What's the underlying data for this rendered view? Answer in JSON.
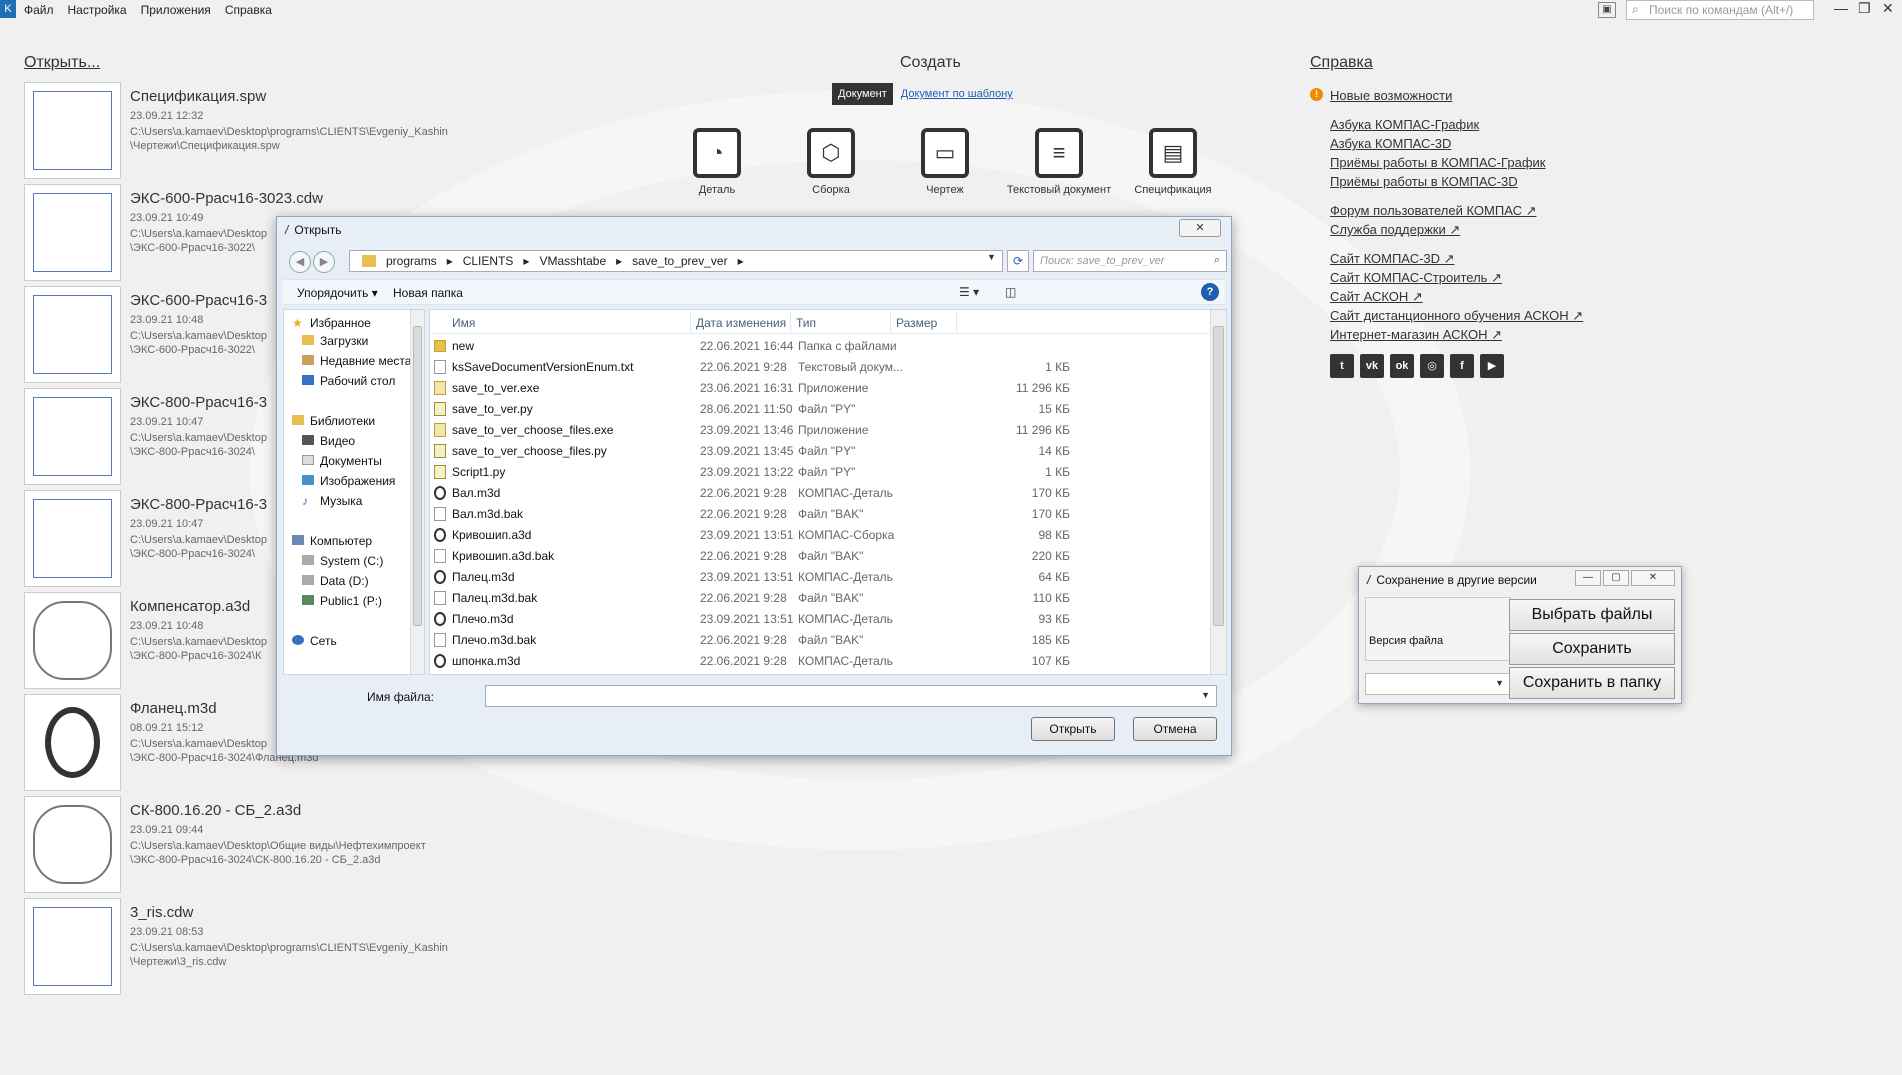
{
  "menu": {
    "items": [
      "Файл",
      "Настройка",
      "Приложения",
      "Справка"
    ],
    "search_placeholder": "Поиск по командам (Alt+/)"
  },
  "sections": {
    "open": "Открыть...",
    "create": "Создать",
    "help": "Справка"
  },
  "recent": [
    {
      "name": "Спецификация.spw",
      "date": "23.09.21 12:32",
      "path": "C:\\Users\\a.kamaev\\Desktop\\programs\\CLIENTS\\Evgeniy_Kashin\n\\Чертежи\\Спецификация.spw"
    },
    {
      "name": "ЭКС-600-Ррасч16-3023.cdw",
      "date": "23.09.21 10:49",
      "path": "C:\\Users\\a.kamaev\\Desktop\n\\ЭКС-600-Ррасч16-3022\\"
    },
    {
      "name": "ЭКС-600-Ррасч16-3",
      "date": "23.09.21 10:48",
      "path": "C:\\Users\\a.kamaev\\Desktop\n\\ЭКС-600-Ррасч16-3022\\"
    },
    {
      "name": "ЭКС-800-Ррасч16-3",
      "date": "23.09.21 10:47",
      "path": "C:\\Users\\a.kamaev\\Desktop\n\\ЭКС-800-Ррасч16-3024\\"
    },
    {
      "name": "ЭКС-800-Ррасч16-3",
      "date": "23.09.21 10:47",
      "path": "C:\\Users\\a.kamaev\\Desktop\n\\ЭКС-800-Ррасч16-3024\\"
    },
    {
      "name": "Компенсатор.a3d",
      "date": "23.09.21 10:48",
      "path": "C:\\Users\\a.kamaev\\Desktop\n\\ЭКС-800-Ррасч16-3024\\К"
    },
    {
      "name": "Фланец.m3d",
      "date": "08.09.21 15:12",
      "path": "C:\\Users\\a.kamaev\\Desktop\n\\ЭКС-800-Ррасч16-3024\\Фланец.m3d"
    },
    {
      "name": "СК-800.16.20 - СБ_2.a3d",
      "date": "23.09.21 09:44",
      "path": "C:\\Users\\a.kamaev\\Desktop\\Общие виды\\Нефтехимпроект\n\\ЭКС-800-Ррасч16-3024\\СК-800.16.20 - СБ_2.a3d"
    },
    {
      "name": "3_ris.cdw",
      "date": "23.09.21 08:53",
      "path": "C:\\Users\\a.kamaev\\Desktop\\programs\\CLIENTS\\Evgeniy_Kashin\n\\Чертежи\\3_ris.cdw"
    }
  ],
  "create": {
    "tab_document": "Документ",
    "tab_template": "Документ по шаблону",
    "items": [
      "Деталь",
      "Сборка",
      "Чертеж",
      "Текстовый документ",
      "Спецификация"
    ]
  },
  "help": {
    "whats_new": "Новые возможности",
    "group1": [
      "Азбука КОМПАС-График",
      "Азбука КОМПАС-3D",
      "Приёмы работы в КОМПАС-График",
      "Приёмы работы в КОМПАС-3D"
    ],
    "group2": [
      "Форум пользователей КОМПАС ↗",
      "Служба поддержки ↗"
    ],
    "group3": [
      "Сайт КОМПАС-3D ↗",
      "Сайт КОМПАС-Строитель ↗",
      "Сайт АСКОН ↗",
      "Сайт дистанционного обучения АСКОН ↗",
      "Интернет-магазин АСКОН ↗"
    ]
  },
  "dialog": {
    "title": "Открыть",
    "close": "✕",
    "breadcrumb": [
      "programs",
      "CLIENTS",
      "VMasshtabe",
      "save_to_prev_ver"
    ],
    "search_placeholder": "Поиск: save_to_prev_ver",
    "organize": "Упорядочить ▾",
    "new_folder": "Новая папка",
    "tree": {
      "favorites": "Избранное",
      "downloads": "Загрузки",
      "recent": "Недавние места",
      "desktop": "Рабочий стол",
      "libraries": "Библиотеки",
      "video": "Видео",
      "documents": "Документы",
      "images": "Изображения",
      "music": "Музыка",
      "computer": "Компьютер",
      "drive_c": "System (C:)",
      "drive_d": "Data (D:)",
      "drive_p": "Public1 (P:)",
      "network": "Сеть"
    },
    "columns": {
      "name": "Имя",
      "date": "Дата изменения",
      "type": "Тип",
      "size": "Размер"
    },
    "files": [
      {
        "name": "new",
        "date": "22.06.2021 16:44",
        "type": "Папка с файлами",
        "size": "",
        "icon": "folder"
      },
      {
        "name": "ksSaveDocumentVersionEnum.txt",
        "date": "22.06.2021 9:28",
        "type": "Текстовый докум...",
        "size": "1 КБ",
        "icon": "txt"
      },
      {
        "name": "save_to_ver.exe",
        "date": "23.06.2021 16:31",
        "type": "Приложение",
        "size": "11 296 КБ",
        "icon": "exe"
      },
      {
        "name": "save_to_ver.py",
        "date": "28.06.2021 11:50",
        "type": "Файл \"PY\"",
        "size": "15 КБ",
        "icon": "py"
      },
      {
        "name": "save_to_ver_choose_files.exe",
        "date": "23.09.2021 13:46",
        "type": "Приложение",
        "size": "11 296 КБ",
        "icon": "exe"
      },
      {
        "name": "save_to_ver_choose_files.py",
        "date": "23.09.2021 13:45",
        "type": "Файл \"PY\"",
        "size": "14 КБ",
        "icon": "py"
      },
      {
        "name": "Script1.py",
        "date": "23.09.2021 13:22",
        "type": "Файл \"PY\"",
        "size": "1 КБ",
        "icon": "py"
      },
      {
        "name": "Вал.m3d",
        "date": "22.06.2021 9:28",
        "type": "КОМПАС-Деталь",
        "size": "170 КБ",
        "icon": "kompas"
      },
      {
        "name": "Вал.m3d.bak",
        "date": "22.06.2021 9:28",
        "type": "Файл \"BAK\"",
        "size": "170 КБ",
        "icon": "txt"
      },
      {
        "name": "Кривошип.a3d",
        "date": "23.09.2021 13:51",
        "type": "КОМПАС-Сборка",
        "size": "98 КБ",
        "icon": "kompas"
      },
      {
        "name": "Кривошип.a3d.bak",
        "date": "22.06.2021 9:28",
        "type": "Файл \"BAK\"",
        "size": "220 КБ",
        "icon": "txt"
      },
      {
        "name": "Палец.m3d",
        "date": "23.09.2021 13:51",
        "type": "КОМПАС-Деталь",
        "size": "64 КБ",
        "icon": "kompas"
      },
      {
        "name": "Палец.m3d.bak",
        "date": "22.06.2021 9:28",
        "type": "Файл \"BAK\"",
        "size": "110 КБ",
        "icon": "txt"
      },
      {
        "name": "Плечо.m3d",
        "date": "23.09.2021 13:51",
        "type": "КОМПАС-Деталь",
        "size": "93 КБ",
        "icon": "kompas"
      },
      {
        "name": "Плечо.m3d.bak",
        "date": "22.06.2021 9:28",
        "type": "Файл \"BAK\"",
        "size": "185 КБ",
        "icon": "txt"
      },
      {
        "name": "шпонка.m3d",
        "date": "22.06.2021 9:28",
        "type": "КОМПАС-Деталь",
        "size": "107 КБ",
        "icon": "kompas"
      }
    ],
    "filename_label": "Имя файла:",
    "filename_value": "",
    "open_button": "Открыть",
    "cancel_button": "Отмена"
  },
  "savebox": {
    "title": "Сохранение в другие версии",
    "version_label": "Версия файла",
    "version_value": "",
    "choose_files": "Выбрать файлы",
    "save": "Сохранить",
    "save_to_folder": "Сохранить в папку"
  }
}
